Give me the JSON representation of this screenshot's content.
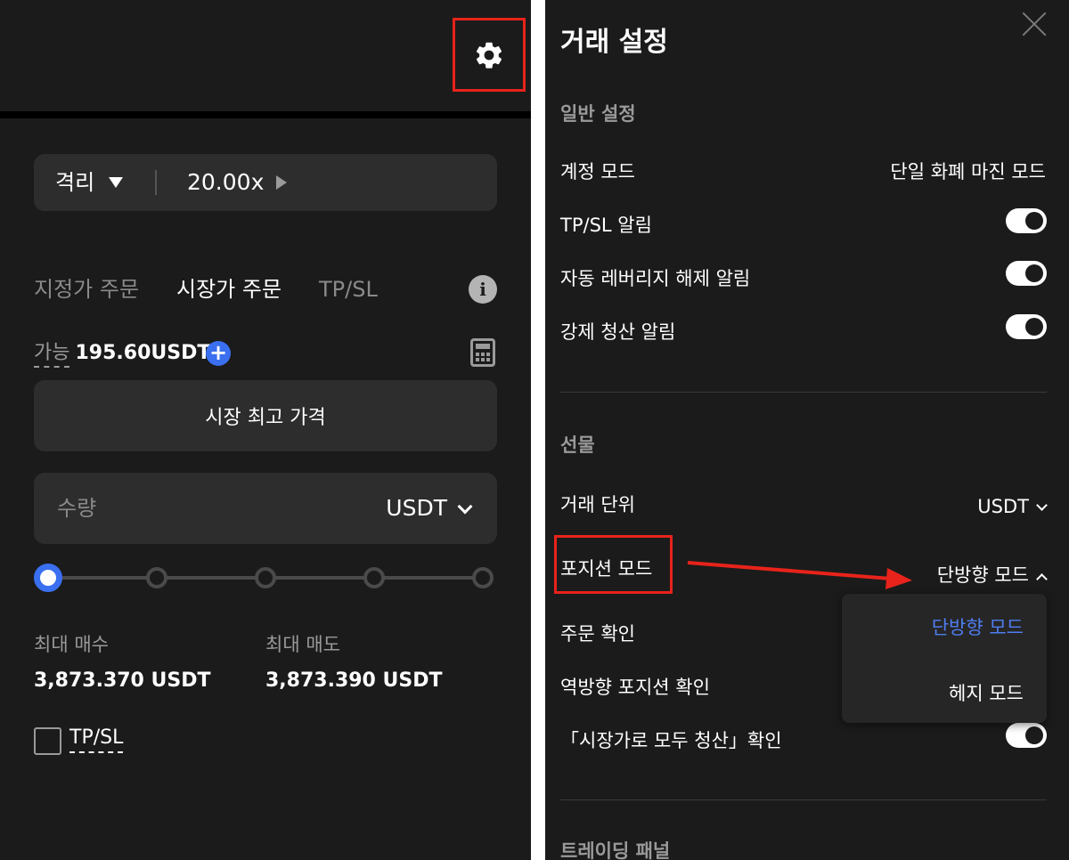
{
  "left": {
    "margin_mode": "격리",
    "leverage": "20.00x",
    "order_tabs": [
      {
        "label": "지정가 주문",
        "active": false
      },
      {
        "label": "시장가 주문",
        "active": true
      },
      {
        "label": "TP/SL",
        "active": false
      }
    ],
    "available_label": "가능",
    "available_value": "195.60USDT",
    "price_label": "시장 최고 가격",
    "quantity_placeholder": "수량",
    "quantity_unit": "USDT",
    "slider_percent": 0,
    "max_buy_label": "최대 매수",
    "max_buy_value": "3,873.370 USDT",
    "max_sell_label": "최대 매도",
    "max_sell_value": "3,873.390 USDT",
    "tpsl_label": "TP/SL"
  },
  "right": {
    "title": "거래 설정",
    "general_section": "일반 설정",
    "account_mode_label": "계정 모드",
    "account_mode_value": "단일 화폐 마진 모드",
    "tpsl_alert_label": "TP/SL 알림",
    "auto_deleverage_label": "자동 레버리지 해제 알림",
    "liquidation_alert_label": "강제 청산 알림",
    "futures_section": "선물",
    "trade_unit_label": "거래 단위",
    "trade_unit_value": "USDT",
    "position_mode_label": "포지션 모드",
    "position_mode_value": "단방향 모드",
    "order_confirm_label": "주문 확인",
    "reverse_position_label": "역방향 포지션 확인",
    "close_all_label": "「시장가로 모두 청산」확인",
    "trading_panel_section": "트레이딩 패널",
    "dropdown_options": [
      "단방향 모드",
      "헤지 모드"
    ]
  },
  "colors": {
    "accent_blue": "#3a6ff0",
    "highlight_red": "#e8231b",
    "panel_bg": "#1b1b1b"
  }
}
